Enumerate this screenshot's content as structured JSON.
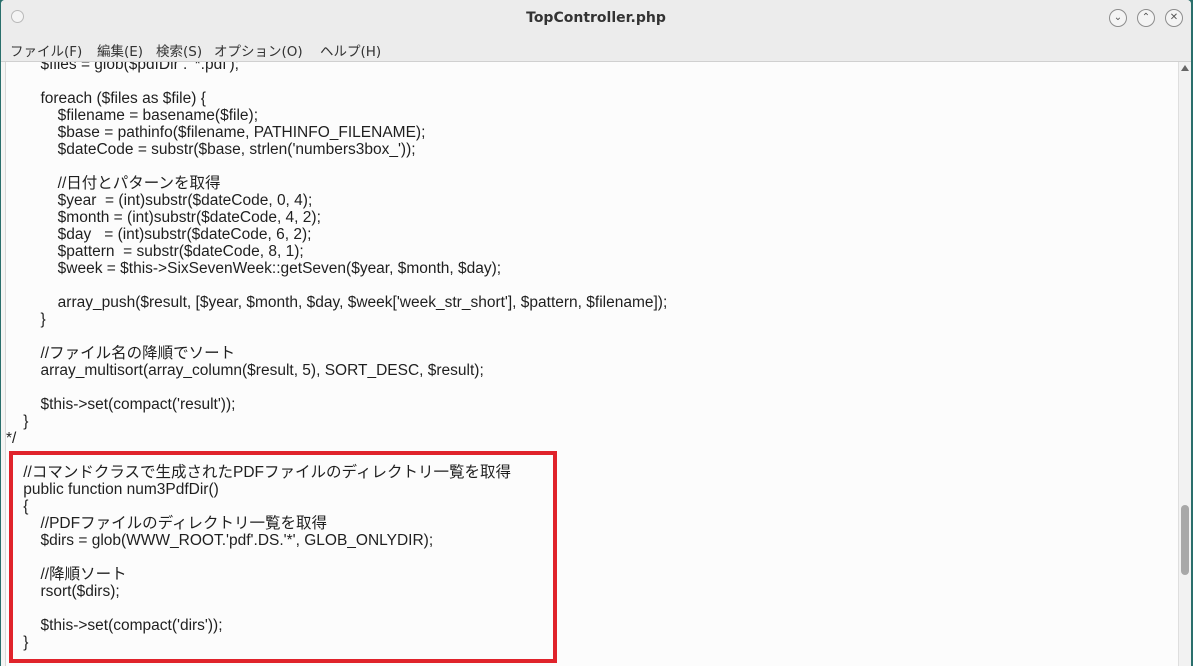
{
  "window": {
    "title": "TopController.php",
    "buttons": {
      "minimize": "⌄",
      "maximize": "⌃",
      "close": "✕"
    }
  },
  "menu": {
    "items": [
      "ファイル(F)",
      "編集(E)",
      "検索(S)",
      "オプション(O)",
      "ヘルプ(H)"
    ]
  },
  "editor": {
    "lines": [
      "        $files = glob($pdfDir . '*.pdf');",
      "",
      "        foreach ($files as $file) {",
      "            $filename = basename($file);",
      "            $base = pathinfo($filename, PATHINFO_FILENAME);",
      "            $dateCode = substr($base, strlen('numbers3box_'));",
      "",
      "            //日付とパターンを取得",
      "            $year  = (int)substr($dateCode, 0, 4);",
      "            $month = (int)substr($dateCode, 4, 2);",
      "            $day   = (int)substr($dateCode, 6, 2);",
      "            $pattern  = substr($dateCode, 8, 1);",
      "            $week = $this->SixSevenWeek::getSeven($year, $month, $day);",
      "",
      "            array_push($result, [$year, $month, $day, $week['week_str_short'], $pattern, $filename]);",
      "        }",
      "",
      "        //ファイル名の降順でソート",
      "        array_multisort(array_column($result, 5), SORT_DESC, $result);",
      "",
      "        $this->set(compact('result'));",
      "    }",
      "*/",
      "",
      "    //コマンドクラスで生成されたPDFファイルのディレクトリ一覧を取得",
      "    public function num3PdfDir()",
      "    {",
      "        //PDFファイルのディレクトリ一覧を取得",
      "        $dirs = glob(WWW_ROOT.'pdf'.DS.'*', GLOB_ONLYDIR);",
      "",
      "        //降順ソート",
      "        rsort($dirs);",
      "",
      "        $this->set(compact('dirs'));",
      "    }"
    ]
  },
  "highlight": {
    "color": "#e0232b"
  }
}
